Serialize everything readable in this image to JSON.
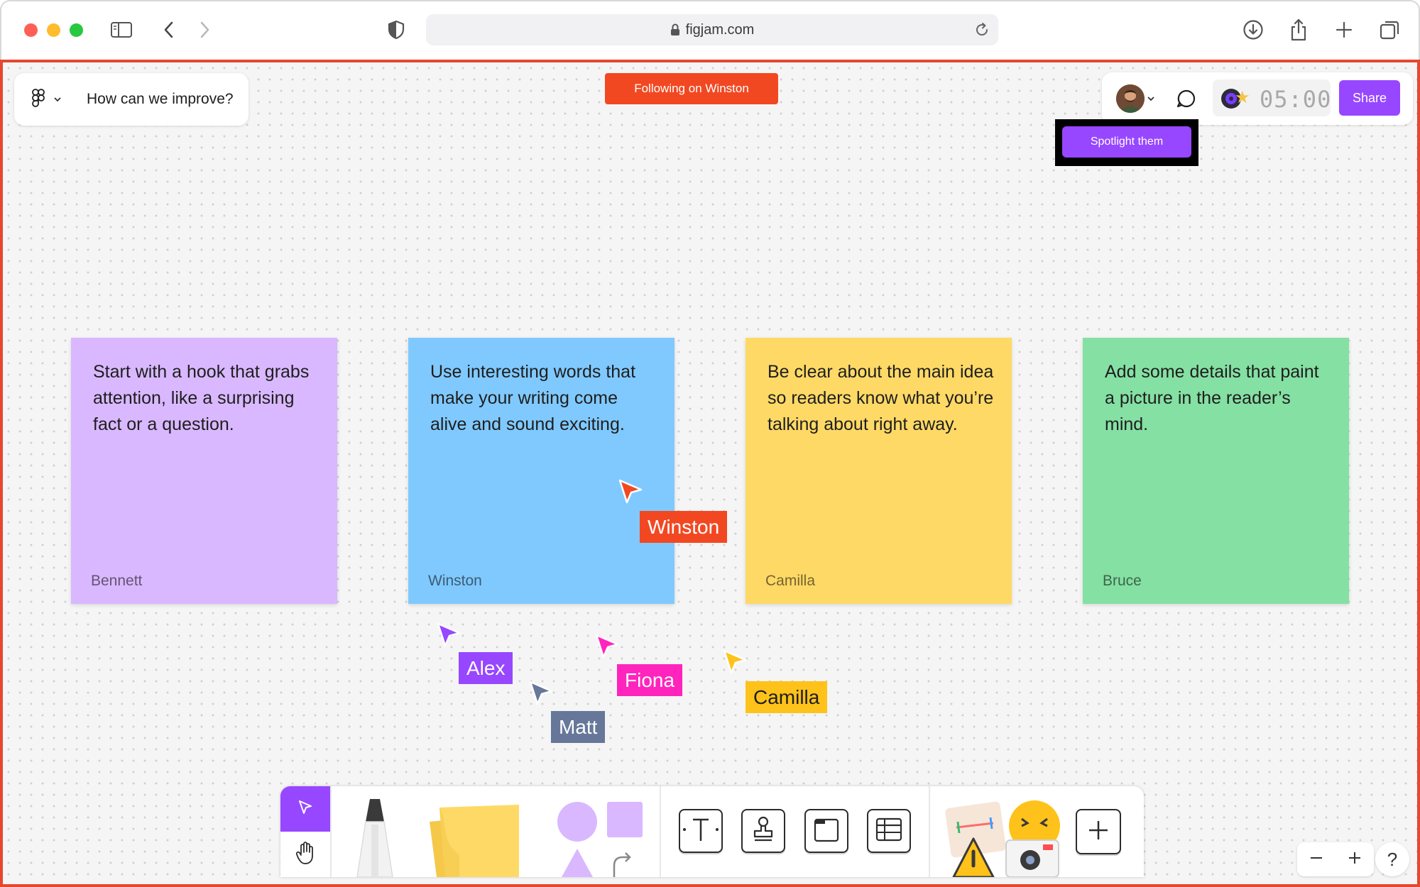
{
  "browser": {
    "url": "figjam.com",
    "colors": {
      "close": "#ff5f57",
      "minimize": "#febc2e",
      "maximize": "#28c840"
    },
    "icons": [
      "sidebar-icon",
      "back-icon",
      "forward-icon",
      "shield-icon",
      "lock-icon",
      "reload-icon",
      "download-icon",
      "share-icon",
      "new-tab-icon",
      "tabs-overview-icon"
    ]
  },
  "header": {
    "file_title": "How can we improve?",
    "following_label": "Following on Winston",
    "timer": "05:00",
    "share_label": "Share",
    "spotlight_label": "Spotlight them"
  },
  "stickies": [
    {
      "text": "Start with a hook that grabs attention, like a surprising fact or a question.",
      "author": "Bennett",
      "color": "#d9b8ff"
    },
    {
      "text": "Use interesting words that make your writing come alive and sound exciting.",
      "author": "Winston",
      "color": "#80c9ff"
    },
    {
      "text": "Be clear about the main idea so readers know what you’re talking about right away.",
      "author": "Camilla",
      "color": "#ffd966"
    },
    {
      "text": "Add some details that paint a picture in the reader’s mind.",
      "author": "Bruce",
      "color": "#85e0a3"
    }
  ],
  "cursors": [
    {
      "name": "Winston",
      "color": "#f24822"
    },
    {
      "name": "Alex",
      "color": "#9747ff"
    },
    {
      "name": "Matt",
      "color": "#667799"
    },
    {
      "name": "Fiona",
      "color": "#ff24bd"
    },
    {
      "name": "Camilla",
      "color": "#ffc21a"
    }
  ],
  "toolbar": {
    "tools": [
      "select-tool",
      "hand-tool",
      "marker-tool",
      "sticky-note-tool",
      "shapes-tool",
      "text-tool",
      "stamp-tool",
      "section-tool",
      "table-tool",
      "stickers-tool",
      "more-tools"
    ]
  },
  "zoom": {
    "help_label": "?"
  },
  "accent": "#9747ff"
}
